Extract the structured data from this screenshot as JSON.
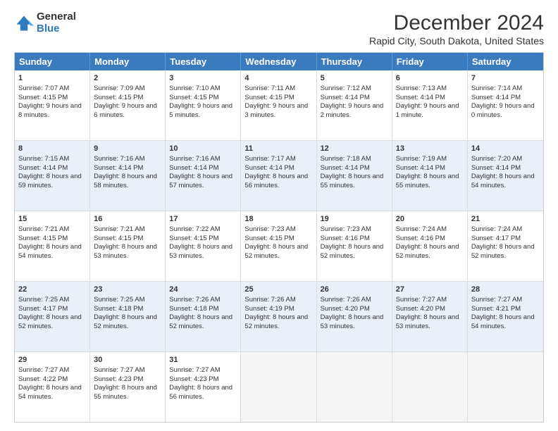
{
  "logo": {
    "general": "General",
    "blue": "Blue"
  },
  "title": "December 2024",
  "subtitle": "Rapid City, South Dakota, United States",
  "days": [
    "Sunday",
    "Monday",
    "Tuesday",
    "Wednesday",
    "Thursday",
    "Friday",
    "Saturday"
  ],
  "rows": [
    [
      {
        "day": "1",
        "sunrise": "Sunrise: 7:07 AM",
        "sunset": "Sunset: 4:15 PM",
        "daylight": "Daylight: 9 hours and 8 minutes."
      },
      {
        "day": "2",
        "sunrise": "Sunrise: 7:09 AM",
        "sunset": "Sunset: 4:15 PM",
        "daylight": "Daylight: 9 hours and 6 minutes."
      },
      {
        "day": "3",
        "sunrise": "Sunrise: 7:10 AM",
        "sunset": "Sunset: 4:15 PM",
        "daylight": "Daylight: 9 hours and 5 minutes."
      },
      {
        "day": "4",
        "sunrise": "Sunrise: 7:11 AM",
        "sunset": "Sunset: 4:15 PM",
        "daylight": "Daylight: 9 hours and 3 minutes."
      },
      {
        "day": "5",
        "sunrise": "Sunrise: 7:12 AM",
        "sunset": "Sunset: 4:14 PM",
        "daylight": "Daylight: 9 hours and 2 minutes."
      },
      {
        "day": "6",
        "sunrise": "Sunrise: 7:13 AM",
        "sunset": "Sunset: 4:14 PM",
        "daylight": "Daylight: 9 hours and 1 minute."
      },
      {
        "day": "7",
        "sunrise": "Sunrise: 7:14 AM",
        "sunset": "Sunset: 4:14 PM",
        "daylight": "Daylight: 9 hours and 0 minutes."
      }
    ],
    [
      {
        "day": "8",
        "sunrise": "Sunrise: 7:15 AM",
        "sunset": "Sunset: 4:14 PM",
        "daylight": "Daylight: 8 hours and 59 minutes."
      },
      {
        "day": "9",
        "sunrise": "Sunrise: 7:16 AM",
        "sunset": "Sunset: 4:14 PM",
        "daylight": "Daylight: 8 hours and 58 minutes."
      },
      {
        "day": "10",
        "sunrise": "Sunrise: 7:16 AM",
        "sunset": "Sunset: 4:14 PM",
        "daylight": "Daylight: 8 hours and 57 minutes."
      },
      {
        "day": "11",
        "sunrise": "Sunrise: 7:17 AM",
        "sunset": "Sunset: 4:14 PM",
        "daylight": "Daylight: 8 hours and 56 minutes."
      },
      {
        "day": "12",
        "sunrise": "Sunrise: 7:18 AM",
        "sunset": "Sunset: 4:14 PM",
        "daylight": "Daylight: 8 hours and 55 minutes."
      },
      {
        "day": "13",
        "sunrise": "Sunrise: 7:19 AM",
        "sunset": "Sunset: 4:14 PM",
        "daylight": "Daylight: 8 hours and 55 minutes."
      },
      {
        "day": "14",
        "sunrise": "Sunrise: 7:20 AM",
        "sunset": "Sunset: 4:14 PM",
        "daylight": "Daylight: 8 hours and 54 minutes."
      }
    ],
    [
      {
        "day": "15",
        "sunrise": "Sunrise: 7:21 AM",
        "sunset": "Sunset: 4:15 PM",
        "daylight": "Daylight: 8 hours and 54 minutes."
      },
      {
        "day": "16",
        "sunrise": "Sunrise: 7:21 AM",
        "sunset": "Sunset: 4:15 PM",
        "daylight": "Daylight: 8 hours and 53 minutes."
      },
      {
        "day": "17",
        "sunrise": "Sunrise: 7:22 AM",
        "sunset": "Sunset: 4:15 PM",
        "daylight": "Daylight: 8 hours and 53 minutes."
      },
      {
        "day": "18",
        "sunrise": "Sunrise: 7:23 AM",
        "sunset": "Sunset: 4:15 PM",
        "daylight": "Daylight: 8 hours and 52 minutes."
      },
      {
        "day": "19",
        "sunrise": "Sunrise: 7:23 AM",
        "sunset": "Sunset: 4:16 PM",
        "daylight": "Daylight: 8 hours and 52 minutes."
      },
      {
        "day": "20",
        "sunrise": "Sunrise: 7:24 AM",
        "sunset": "Sunset: 4:16 PM",
        "daylight": "Daylight: 8 hours and 52 minutes."
      },
      {
        "day": "21",
        "sunrise": "Sunrise: 7:24 AM",
        "sunset": "Sunset: 4:17 PM",
        "daylight": "Daylight: 8 hours and 52 minutes."
      }
    ],
    [
      {
        "day": "22",
        "sunrise": "Sunrise: 7:25 AM",
        "sunset": "Sunset: 4:17 PM",
        "daylight": "Daylight: 8 hours and 52 minutes."
      },
      {
        "day": "23",
        "sunrise": "Sunrise: 7:25 AM",
        "sunset": "Sunset: 4:18 PM",
        "daylight": "Daylight: 8 hours and 52 minutes."
      },
      {
        "day": "24",
        "sunrise": "Sunrise: 7:26 AM",
        "sunset": "Sunset: 4:18 PM",
        "daylight": "Daylight: 8 hours and 52 minutes."
      },
      {
        "day": "25",
        "sunrise": "Sunrise: 7:26 AM",
        "sunset": "Sunset: 4:19 PM",
        "daylight": "Daylight: 8 hours and 52 minutes."
      },
      {
        "day": "26",
        "sunrise": "Sunrise: 7:26 AM",
        "sunset": "Sunset: 4:20 PM",
        "daylight": "Daylight: 8 hours and 53 minutes."
      },
      {
        "day": "27",
        "sunrise": "Sunrise: 7:27 AM",
        "sunset": "Sunset: 4:20 PM",
        "daylight": "Daylight: 8 hours and 53 minutes."
      },
      {
        "day": "28",
        "sunrise": "Sunrise: 7:27 AM",
        "sunset": "Sunset: 4:21 PM",
        "daylight": "Daylight: 8 hours and 54 minutes."
      }
    ],
    [
      {
        "day": "29",
        "sunrise": "Sunrise: 7:27 AM",
        "sunset": "Sunset: 4:22 PM",
        "daylight": "Daylight: 8 hours and 54 minutes."
      },
      {
        "day": "30",
        "sunrise": "Sunrise: 7:27 AM",
        "sunset": "Sunset: 4:23 PM",
        "daylight": "Daylight: 8 hours and 55 minutes."
      },
      {
        "day": "31",
        "sunrise": "Sunrise: 7:27 AM",
        "sunset": "Sunset: 4:23 PM",
        "daylight": "Daylight: 8 hours and 56 minutes."
      },
      null,
      null,
      null,
      null
    ]
  ]
}
